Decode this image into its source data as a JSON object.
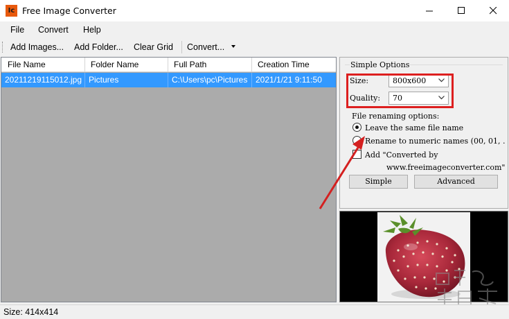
{
  "window": {
    "title": "Free Image Converter",
    "icon_text": "Ic",
    "controls": [
      "minimize-icon",
      "maximize-icon",
      "close-icon"
    ]
  },
  "menu": {
    "items": [
      {
        "label": "File"
      },
      {
        "label": "Convert"
      },
      {
        "label": "Help"
      }
    ]
  },
  "toolbar": {
    "add_images": "Add Images...",
    "add_folder": "Add Folder...",
    "clear_grid": "Clear Grid",
    "convert": "Convert..."
  },
  "grid": {
    "columns": [
      "File Name",
      "Folder Name",
      "Full Path",
      "Creation Time"
    ],
    "rows": [
      [
        "20211219115012.jpg",
        "Pictures",
        "C:\\Users\\pc\\Pictures",
        "2021/1/21 9:11:50"
      ]
    ],
    "selection_color": "#3399ff"
  },
  "options": {
    "group_title": "Simple Options",
    "size_label": "Size:",
    "size_value": "800x600",
    "quality_label": "Quality:",
    "quality_value": "70",
    "renaming_label": "File renaming options:",
    "radio_same": "Leave the same file name",
    "radio_same_checked": true,
    "radio_numeric": "Rename to numeric names (00, 01, .",
    "radio_numeric_checked": false,
    "check_add": "Add \"Converted by",
    "check_add_line2": "www.freeimageconverter.com\"",
    "check_add_checked": false,
    "simple_button": "Simple",
    "advanced_button": "Advanced",
    "highlight_color": "#dd1f1f"
  },
  "preview": {
    "subject": "strawberry"
  },
  "status": {
    "text": "Size: 414x414"
  }
}
